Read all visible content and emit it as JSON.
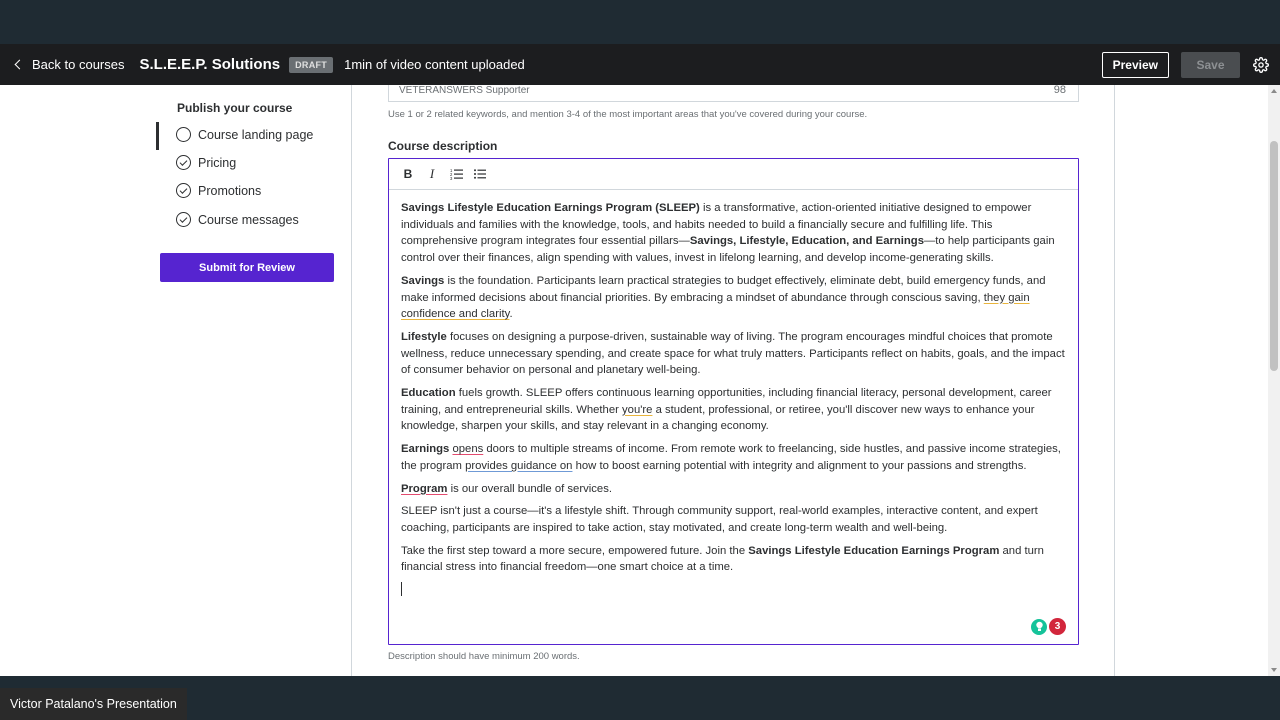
{
  "header": {
    "back_label": "Back to courses",
    "course_title": "S.L.E.E.P. Solutions",
    "status_badge": "DRAFT",
    "upload_status": "1min of video content uploaded",
    "preview_label": "Preview",
    "save_label": "Save"
  },
  "sidebar": {
    "heading": "Publish your course",
    "items": [
      {
        "label": "Course landing page",
        "state": "active"
      },
      {
        "label": "Pricing",
        "state": "complete"
      },
      {
        "label": "Promotions",
        "state": "complete"
      },
      {
        "label": "Course messages",
        "state": "complete"
      }
    ],
    "submit_label": "Submit for Review"
  },
  "keywords": {
    "value": "VETERANSWERS Supporter",
    "char_count": "98",
    "help": "Use 1 or 2 related keywords, and mention 3-4 of the most important areas that you've covered during your course."
  },
  "description": {
    "label": "Course description",
    "toolbar": {
      "bold": "B",
      "italic": "I"
    },
    "p1_b1": "Savings Lifestyle Education Earnings Program (SLEEP)",
    "p1_t1": " is a transformative, action-oriented initiative designed to empower individuals and families with the knowledge, tools, and habits needed to build a financially secure and fulfilling life. This comprehensive program integrates four essential pillars—",
    "p1_b2": "Savings, Lifestyle, Education, and Earnings",
    "p1_t2": "—to help participants gain control over their finances, align spending with values, invest in lifelong learning, and develop income-generating skills.",
    "p2_b": "Savings",
    "p2_t1": " is the foundation. Participants learn practical strategies to budget effectively, eliminate debt, build emergency funds, and make informed decisions about financial priorities. By embracing a mindset of abundance through conscious saving, ",
    "p2_u": "they gain confidence and clarity",
    "p2_t2": ".",
    "p3_b": "Lifestyle",
    "p3_t": " focuses on designing a purpose-driven, sustainable way of living. The program encourages mindful choices that promote wellness, reduce unnecessary spending, and create space for what truly matters. Participants reflect on habits, goals, and the impact of consumer behavior on personal and planetary well-being.",
    "p4_b": "Education",
    "p4_t1": " fuels growth. SLEEP offers continuous learning opportunities, including financial literacy, personal development, career training, and entrepreneurial skills. Whether ",
    "p4_u": "you're",
    "p4_t2": " a student, professional, or retiree, you'll discover new ways to enhance your knowledge, sharpen your skills, and stay relevant in a changing economy.",
    "p5_b": "Earnings",
    "p5_s": " ",
    "p5_u1": "opens",
    "p5_t1": " doors to multiple streams of income. From remote work to freelancing, side hustles, and passive income strategies, the program ",
    "p5_u2": "provides guidance on",
    "p5_t2": " how to boost earning potential with integrity and alignment to your passions and strengths.",
    "p6_b": "Program",
    "p6_t": " is our overall bundle of services.",
    "p7_t": "SLEEP isn't just a course—it's a lifestyle shift. Through community support, real-world examples, interactive content, and expert coaching, participants are inspired to take action, stay motivated, and create long-term wealth and well-being.",
    "p8_t1": "Take the first step toward a more secure, empowered future. Join the ",
    "p8_b": "Savings Lifestyle Education Earnings Program",
    "p8_t2": " and turn financial stress into financial freedom—one smart choice at a time.",
    "grammarly_count": "3",
    "help": "Description should have minimum 200 words."
  },
  "presenter": "Victor Patalano's Presentation",
  "colors": {
    "accent": "#5624d0",
    "header_bg": "#1c1d1f",
    "grammarly_green": "#15c39a",
    "grammarly_red": "#d2263c"
  }
}
